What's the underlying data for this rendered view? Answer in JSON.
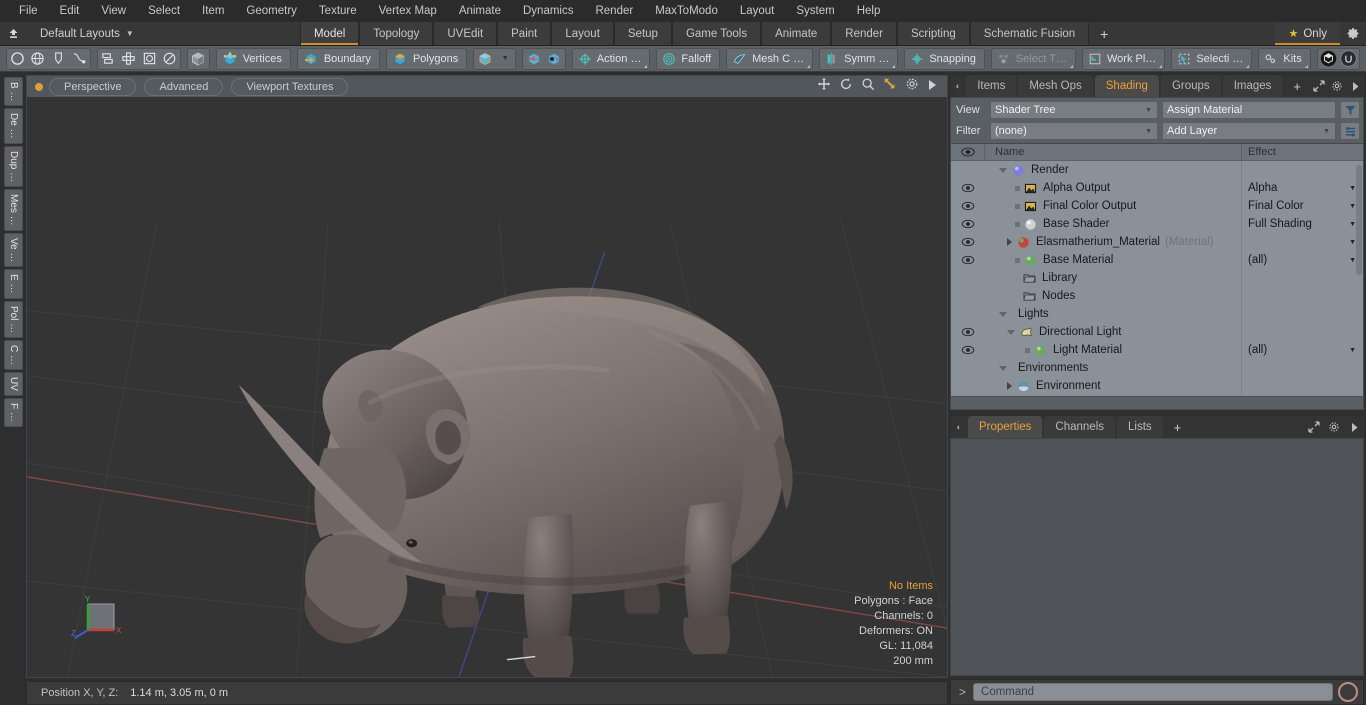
{
  "menubar": {
    "items": [
      "File",
      "Edit",
      "View",
      "Select",
      "Item",
      "Geometry",
      "Texture",
      "Vertex Map",
      "Animate",
      "Dynamics",
      "Render",
      "MaxToModo",
      "Layout",
      "System",
      "Help"
    ]
  },
  "layoutbar": {
    "home_icon": "home-up-icon",
    "layout_name": "Default Layouts",
    "caret": "▼",
    "tabs": [
      {
        "label": "Model",
        "active": true
      },
      {
        "label": "Topology",
        "active": false
      },
      {
        "label": "UVEdit",
        "active": false
      },
      {
        "label": "Paint",
        "active": false
      },
      {
        "label": "Layout",
        "active": false
      },
      {
        "label": "Setup",
        "active": false
      },
      {
        "label": "Game Tools",
        "active": false
      },
      {
        "label": "Animate",
        "active": false
      },
      {
        "label": "Render",
        "active": false
      },
      {
        "label": "Scripting",
        "active": false
      },
      {
        "label": "Schematic Fusion",
        "active": false
      }
    ],
    "add_tab": "+",
    "only_star": "★",
    "only_label": "Only",
    "gear_icon": "gear-icon"
  },
  "toolbar": {
    "group1": [
      "circle-icon",
      "globe-icon",
      "pen-icon",
      "curve-icon"
    ],
    "group2": [
      "align-icon",
      "center-icon",
      "square-circle-icon",
      "circle-slash-icon"
    ],
    "group3": [
      "cube-solid-icon"
    ],
    "modes": [
      {
        "label": "Vertices",
        "icon": "cube-vertices-icon",
        "dim": false
      },
      {
        "label": "Boundary",
        "icon": "cube-boundary-icon",
        "dim": false
      },
      {
        "label": "Polygons",
        "icon": "cube-polygons-icon",
        "dim": false
      }
    ],
    "cube_dropdown_icon": "cube-icon",
    "cube_caret": "▼",
    "snap_icons": [
      "snap-a-icon",
      "snap-b-icon"
    ],
    "tools": [
      {
        "label": "Action  …",
        "icon": "action-center-icon",
        "dim": false
      },
      {
        "label": "Falloff",
        "icon": "falloff-icon",
        "dim": false
      },
      {
        "label": "Mesh C …",
        "icon": "mesh-constraint-icon",
        "dim": false
      },
      {
        "label": "Symm …",
        "icon": "symmetry-icon",
        "dim": false
      },
      {
        "label": "Snapping",
        "icon": "snapping-icon",
        "dim": false
      },
      {
        "label": "Select T…",
        "icon": "select-through-icon",
        "dim": true
      },
      {
        "label": "Work Pl…",
        "icon": "work-plane-icon",
        "dim": false
      },
      {
        "label": "Selecti …",
        "icon": "selection-icon",
        "dim": false
      },
      {
        "label": "Kits",
        "icon": "kits-icon",
        "dim": false
      }
    ],
    "right_icons": [
      "modo-cube-icon",
      "unreal-icon"
    ]
  },
  "left_vtabs": [
    {
      "label": "B …"
    },
    {
      "label": "De …"
    },
    {
      "label": "Dup …"
    },
    {
      "label": "Mes …"
    },
    {
      "label": "Ve …"
    },
    {
      "label": "E …"
    },
    {
      "label": "Pol …"
    },
    {
      "label": "C …"
    },
    {
      "label": "UV"
    },
    {
      "label": "F …"
    }
  ],
  "viewport": {
    "dot_color": "#d8a13a",
    "segments": [
      "Perspective",
      "Advanced",
      "Viewport Textures"
    ],
    "nav_icons": [
      "move-icon",
      "rotate-icon",
      "zoom-icon",
      "fit-icon",
      "gear-icon",
      "play-icon"
    ],
    "stats": {
      "items_label": "No Items",
      "polygons": "Polygons : Face",
      "channels": "Channels: 0",
      "deformers": "Deformers: ON",
      "gl": "GL: 11,084",
      "grid": "200 mm"
    },
    "gizmo": {
      "x": "X",
      "y": "Y",
      "z": "Z",
      "x_color": "#c04040",
      "y_color": "#3fa33f",
      "z_color": "#3a5fd0"
    }
  },
  "statusbar": {
    "position_label": "Position X, Y, Z:",
    "position_value": "1.14 m, 3.05 m, 0 m"
  },
  "right_panel": {
    "tabs": [
      {
        "label": "Items",
        "active": false
      },
      {
        "label": "Mesh Ops",
        "active": false
      },
      {
        "label": "Shading",
        "active": true
      },
      {
        "label": "Groups",
        "active": false
      },
      {
        "label": "Images",
        "active": false
      }
    ],
    "add_tab": "+",
    "corner_icons": [
      "expand-icon",
      "gear-icon",
      "arrow-right-icon"
    ],
    "controls": {
      "view_label": "View",
      "view_value": "Shader Tree",
      "assign_value": "Assign Material",
      "filter_label": "Filter",
      "filter_value": "(none)",
      "add_layer_value": "Add Layer",
      "funnel_icon": "filter-funnel-icon",
      "list_icon": "list-options-icon"
    },
    "tree_headers": {
      "eye": "eye-icon",
      "name": "Name",
      "effect": "Effect"
    },
    "tree_rows": [
      {
        "name": "Render",
        "effect": "",
        "indent": 0,
        "eye": false,
        "twisty": "down",
        "icon": "sphere-blue-icon",
        "sub": ""
      },
      {
        "name": "Alpha Output",
        "effect": "Alpha",
        "indent": 1,
        "eye": true,
        "twisty": "leaf",
        "icon": "output-icon",
        "sub": ""
      },
      {
        "name": "Final Color Output",
        "effect": "Final Color",
        "indent": 1,
        "eye": true,
        "twisty": "leaf",
        "icon": "output-icon",
        "sub": ""
      },
      {
        "name": "Base Shader",
        "effect": "Full Shading",
        "indent": 1,
        "eye": true,
        "twisty": "leaf",
        "icon": "sphere-white-icon",
        "sub": ""
      },
      {
        "name": "Elasmatherium_Material",
        "effect": "",
        "indent": 1,
        "eye": true,
        "twisty": "right",
        "icon": "sphere-red-icon",
        "sub": "(Material)"
      },
      {
        "name": "Base Material",
        "effect": "(all)",
        "indent": 1,
        "eye": true,
        "twisty": "leaf",
        "icon": "sphere-green-icon",
        "sub": ""
      },
      {
        "name": "Library",
        "effect": "",
        "indent": 1,
        "eye": false,
        "twisty": "none",
        "icon": "folder-icon",
        "sub": ""
      },
      {
        "name": "Nodes",
        "effect": "",
        "indent": 1,
        "eye": false,
        "twisty": "none",
        "icon": "folder-icon",
        "sub": ""
      },
      {
        "name": "Lights",
        "effect": "",
        "indent": 0,
        "eye": false,
        "twisty": "down",
        "icon": "none",
        "sub": ""
      },
      {
        "name": "Directional Light",
        "effect": "",
        "indent": 1,
        "eye": true,
        "twisty": "down",
        "icon": "light-icon",
        "sub": ""
      },
      {
        "name": "Light Material",
        "effect": "(all)",
        "indent": 2,
        "eye": true,
        "twisty": "leaf",
        "icon": "sphere-green-icon",
        "sub": ""
      },
      {
        "name": "Environments",
        "effect": "",
        "indent": 0,
        "eye": false,
        "twisty": "down",
        "icon": "none",
        "sub": ""
      },
      {
        "name": "Environment",
        "effect": "",
        "indent": 1,
        "eye": false,
        "twisty": "right",
        "icon": "env-icon",
        "sub": ""
      }
    ],
    "props_tabs": [
      {
        "label": "Properties",
        "active": true
      },
      {
        "label": "Channels",
        "active": false
      },
      {
        "label": "Lists",
        "active": false
      }
    ],
    "props_add": "+"
  },
  "command_bar": {
    "prompt": "&gt;",
    "placeholder": "Command",
    "record_icon": "record-circle-icon"
  }
}
